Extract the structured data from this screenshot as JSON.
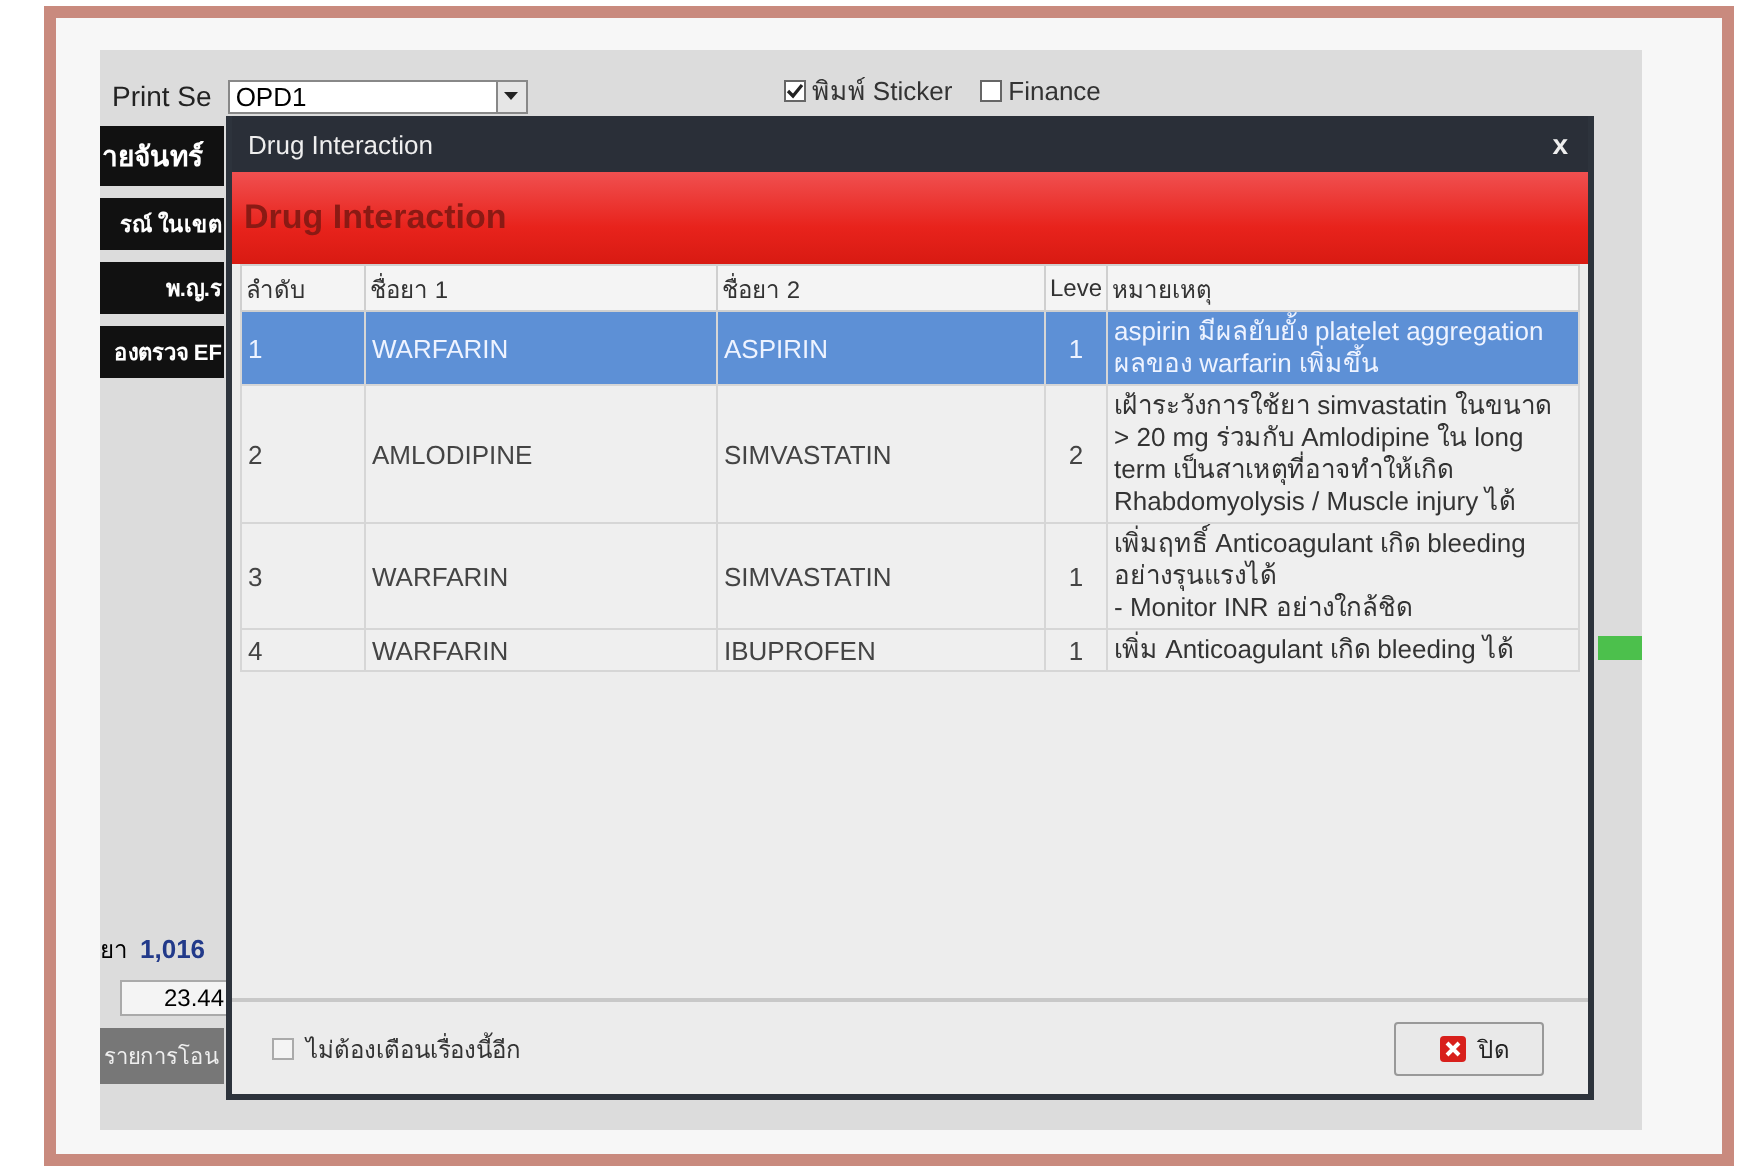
{
  "background_window": {
    "print_server_label": "Print Se",
    "print_server_value": "OPD1",
    "options": [
      {
        "label": "พิมพ์ Sticker",
        "checked": true
      },
      {
        "label": "Finance",
        "checked": false
      }
    ],
    "side_labels": [
      "ายจันทร์",
      "รณ์ ในเขต",
      "พ.ญ.ร",
      "องตรวจ EF"
    ],
    "drug_count_label": "ยา",
    "drug_count": "1,016",
    "amount": "23.44",
    "transfer_button": "รายการโอน"
  },
  "dialog": {
    "title": "Drug Interaction",
    "close": "x",
    "header": "Drug Interaction",
    "columns": [
      "ลำดับ",
      "ชื่อยา 1",
      "ชื่อยา 2",
      "Leve",
      "หมายเหตุ"
    ],
    "rows": [
      {
        "no": "1",
        "drug_1": "WARFARIN",
        "drug_2": "ASPIRIN",
        "level": "1",
        "note": "aspirin มีผลยับยั้ง platelet aggregation ผลของ warfarin เพิ่มขึ้น",
        "selected": true
      },
      {
        "no": "2",
        "drug_1": "AMLODIPINE",
        "drug_2": "SIMVASTATIN",
        "level": "2",
        "note": "เฝ้าระวังการใช้ยา simvastatin ในขนาด > 20 mg ร่วมกับ Amlodipine ใน long term เป็นสาเหตุที่อาจทำให้เกิด Rhabdomyolysis / Muscle injury ได้",
        "selected": false
      },
      {
        "no": "3",
        "drug_1": "WARFARIN",
        "drug_2": "SIMVASTATIN",
        "level": "1",
        "note": "เพิ่มฤทธิ์ Anticoagulant เกิด bleeding อย่างรุนแรงได้\n- Monitor INR อย่างใกล้ชิด",
        "selected": false
      },
      {
        "no": "4",
        "drug_1": "WARFARIN",
        "drug_2": "IBUPROFEN",
        "level": "1",
        "note": "เพิ่ม Anticoagulant เกิด bleeding ได้",
        "selected": false
      }
    ],
    "dont_warn": {
      "label": "ไม่ต้องเตือนเรื่องนี้อีก",
      "checked": false
    },
    "close_button": "ปิด"
  }
}
